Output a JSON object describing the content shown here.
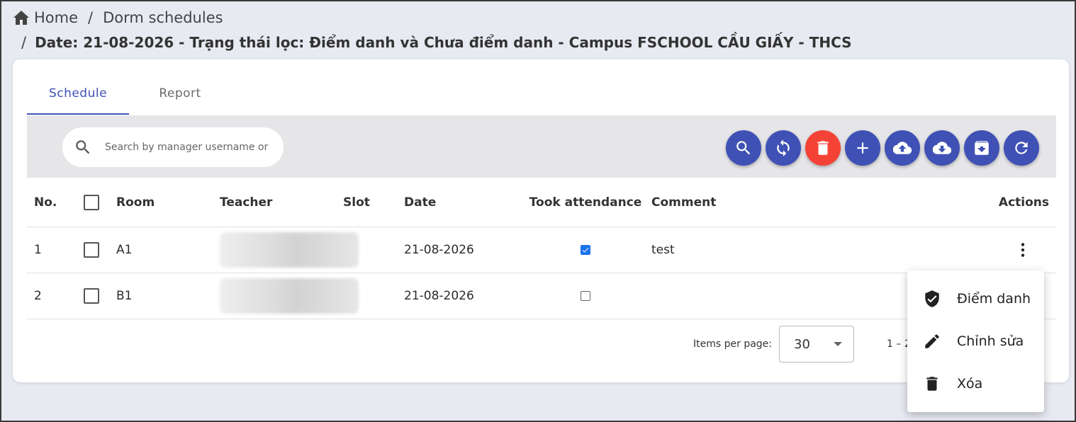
{
  "breadcrumb": {
    "home": "Home",
    "sep": "/",
    "section": "Dorm schedules",
    "current": "Date: 21-08-2026 - Trạng thái lọc: Điểm danh và Chưa điểm danh - Campus FSCHOOL CẦU GIẤY - THCS"
  },
  "tabs": [
    {
      "label": "Schedule",
      "active": true
    },
    {
      "label": "Report",
      "active": false
    }
  ],
  "search": {
    "placeholder": "Search by manager username or"
  },
  "toolbar_icons": [
    "search-icon",
    "sync-icon",
    "delete-icon",
    "add-icon",
    "cloud-upload-icon",
    "cloud-download-icon",
    "archive-icon",
    "refresh-icon"
  ],
  "colors": {
    "primary": "#3f51b5",
    "warn": "#f44336",
    "checkbox": "#1a73e8"
  },
  "table": {
    "headers": {
      "no": "No.",
      "room": "Room",
      "teacher": "Teacher",
      "slot": "Slot",
      "date": "Date",
      "attendance": "Took attendance",
      "comment": "Comment",
      "actions": "Actions"
    },
    "rows": [
      {
        "no": "1",
        "room": "A1",
        "slot": "",
        "date": "21-08-2026",
        "attendance": true,
        "comment": "test"
      },
      {
        "no": "2",
        "room": "B1",
        "slot": "",
        "date": "21-08-2026",
        "attendance": false,
        "comment": ""
      }
    ]
  },
  "paginator": {
    "label": "Items per page:",
    "value": "30",
    "range": "1 – 2"
  },
  "menu": [
    {
      "label": "Điểm danh",
      "icon": "verified-shield-icon"
    },
    {
      "label": "Chỉnh sửa",
      "icon": "edit-icon"
    },
    {
      "label": "Xóa",
      "icon": "delete-icon"
    }
  ]
}
